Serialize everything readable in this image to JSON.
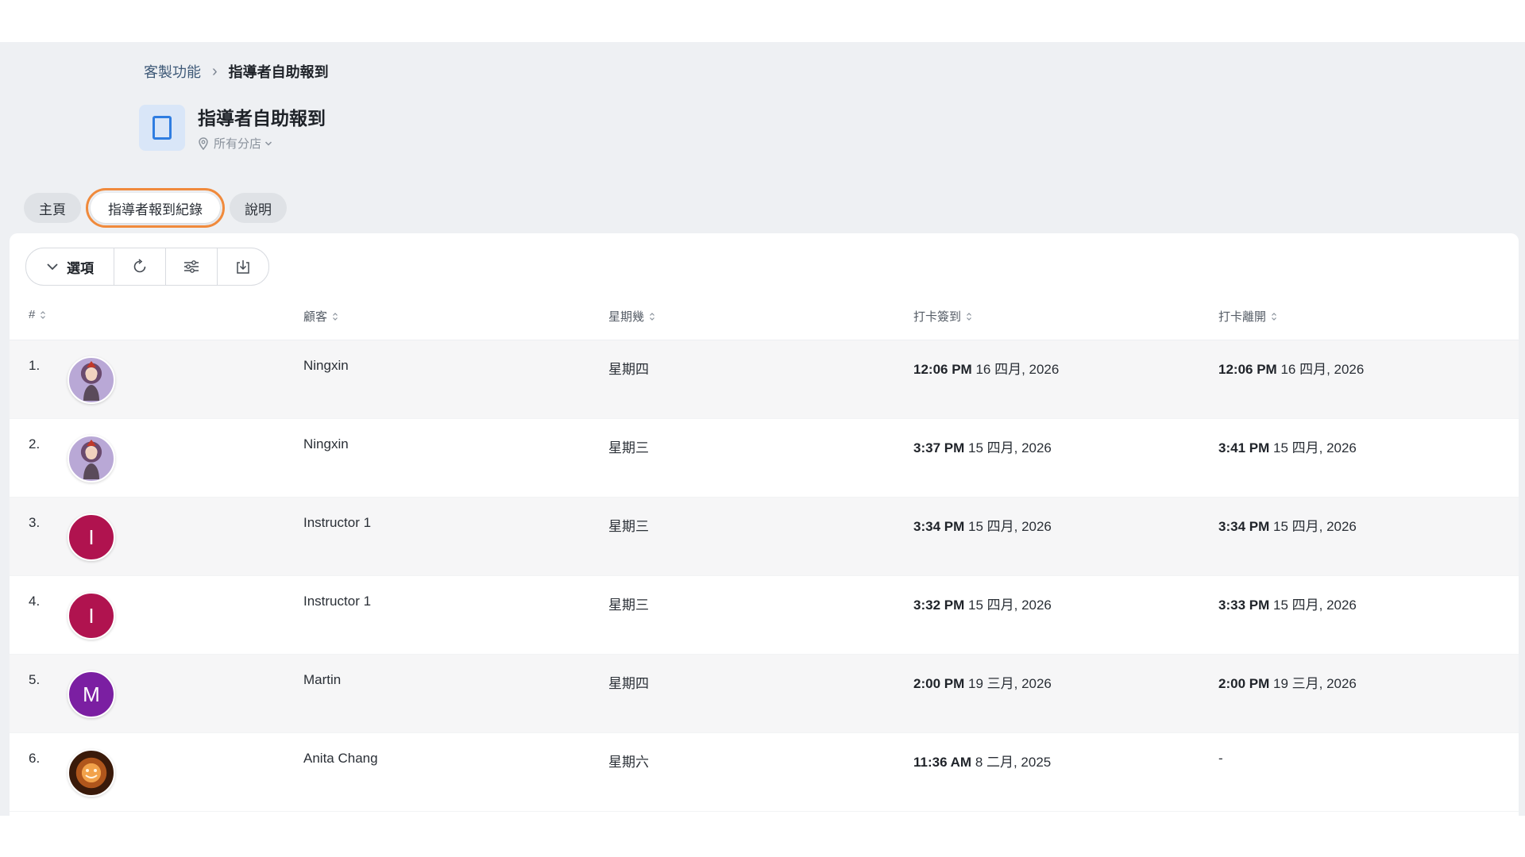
{
  "breadcrumb": {
    "parent": "客製功能",
    "current": "指導者自助報到"
  },
  "app": {
    "title": "指導者自助報到",
    "branch": "所有分店"
  },
  "tabs": [
    {
      "label": "主頁",
      "active": false
    },
    {
      "label": "指導者報到紀錄",
      "active": true
    },
    {
      "label": "說明",
      "active": false
    }
  ],
  "toolbar": {
    "options_label": "選項",
    "icons": [
      "refresh-icon",
      "filter-sliders-icon",
      "download-icon"
    ]
  },
  "table": {
    "columns": [
      "#",
      "顧客",
      "星期幾",
      "打卡簽到",
      "打卡離開"
    ],
    "rows": [
      {
        "index": "1.",
        "avatar": "photo",
        "avatar_color": "#b8a7c9",
        "name": "Ningxin",
        "day": "星期四",
        "in_time": "12:06 PM",
        "in_date": "16 四月, 2026",
        "out_time": "12:06 PM",
        "out_date": "16 四月, 2026"
      },
      {
        "index": "2.",
        "avatar": "photo",
        "avatar_color": "#b8a7c9",
        "name": "Ningxin",
        "day": "星期三",
        "in_time": "3:37 PM",
        "in_date": "15 四月, 2026",
        "out_time": "3:41 PM",
        "out_date": "15 四月, 2026"
      },
      {
        "index": "3.",
        "avatar": "I",
        "avatar_color": "#b0134f",
        "name": "Instructor 1",
        "day": "星期三",
        "in_time": "3:34 PM",
        "in_date": "15 四月, 2026",
        "out_time": "3:34 PM",
        "out_date": "15 四月, 2026"
      },
      {
        "index": "4.",
        "avatar": "I",
        "avatar_color": "#b0134f",
        "name": "Instructor 1",
        "day": "星期三",
        "in_time": "3:32 PM",
        "in_date": "15 四月, 2026",
        "out_time": "3:33 PM",
        "out_date": "15 四月, 2026"
      },
      {
        "index": "5.",
        "avatar": "M",
        "avatar_color": "#7b1fa2",
        "name": "Martin",
        "day": "星期四",
        "in_time": "2:00 PM",
        "in_date": "19 三月, 2026",
        "out_time": "2:00 PM",
        "out_date": "19 三月, 2026"
      },
      {
        "index": "6.",
        "avatar": "photo",
        "avatar_color": "#7a3f14",
        "name": "Anita Chang",
        "day": "星期六",
        "in_time": "11:36 AM",
        "in_date": "8 二月, 2025",
        "out_time": "",
        "out_date": "-"
      }
    ]
  },
  "colors": {
    "accent_highlight": "#f08a3c",
    "app_icon_bg": "#d9e6f8",
    "app_icon_fg": "#2f7de1"
  }
}
